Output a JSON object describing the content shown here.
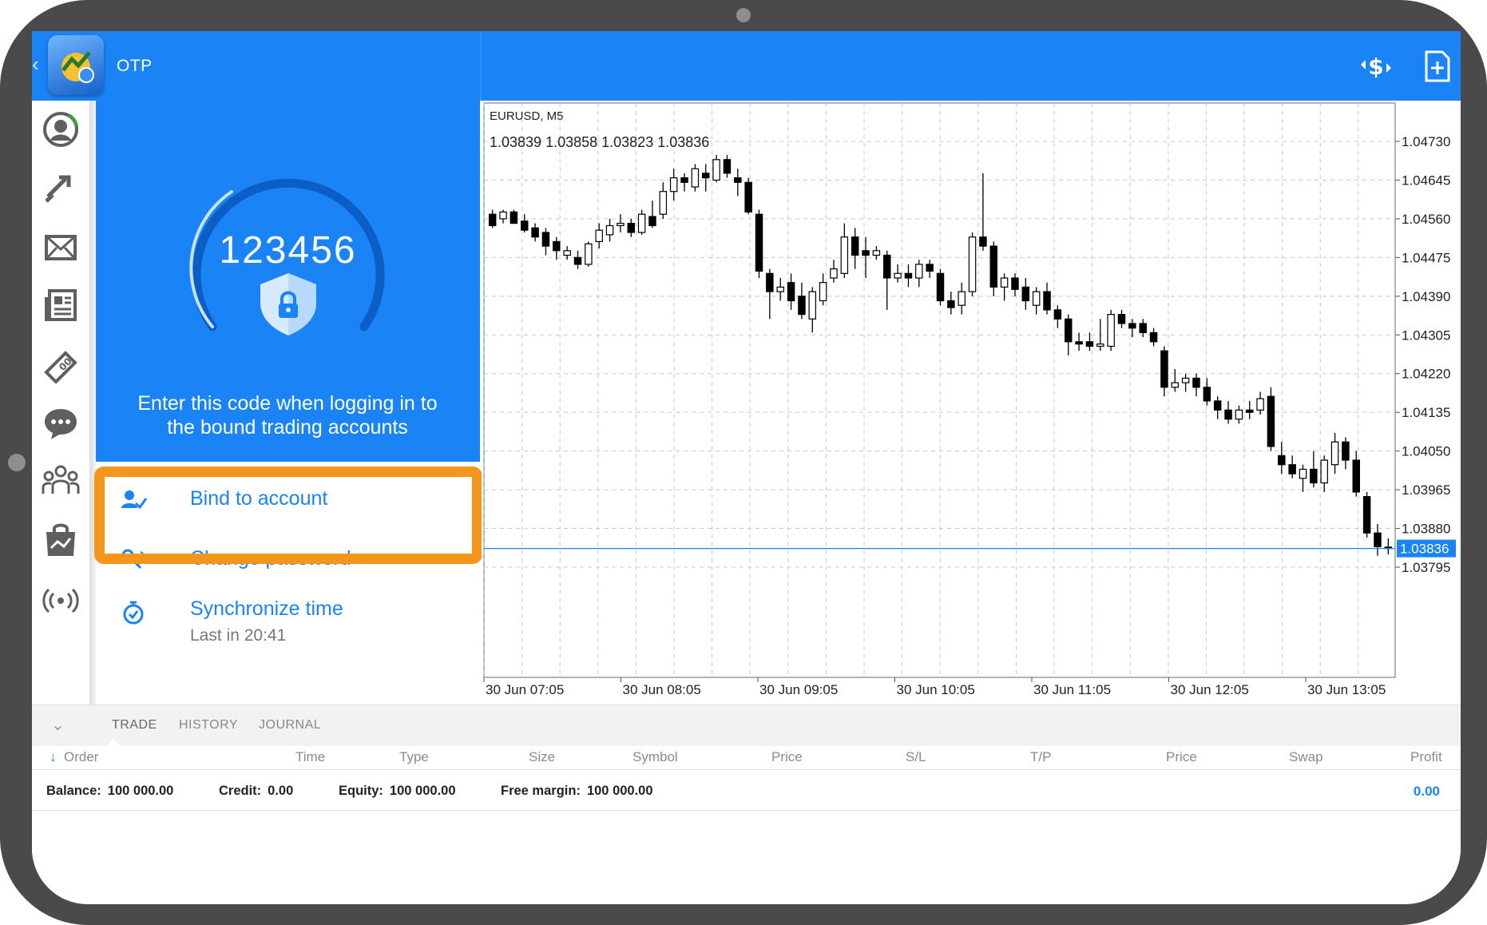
{
  "header": {
    "title": "OTP",
    "back_icon": "chevron-left-icon",
    "currency_icon": "currency-exchange-icon",
    "new_order_icon": "add-document-icon"
  },
  "sidebar": {
    "items": [
      {
        "icon": "account-icon"
      },
      {
        "icon": "trade-icon"
      },
      {
        "icon": "mail-icon"
      },
      {
        "icon": "news-icon"
      },
      {
        "icon": "calendar-icon"
      },
      {
        "icon": "chat-icon"
      },
      {
        "icon": "community-icon"
      },
      {
        "icon": "market-icon"
      },
      {
        "icon": "signals-icon"
      }
    ]
  },
  "otp": {
    "code": "123456",
    "hint": "Enter this code when logging in to the bound trading accounts",
    "lock_icon": "shield-lock-icon"
  },
  "menu": {
    "bind": {
      "label": "Bind to account",
      "icon": "bind-user-icon"
    },
    "change_password": {
      "label": "Change password",
      "icon": "key-icon"
    },
    "sync_time": {
      "label": "Synchronize time",
      "sub": "Last in 20:41",
      "icon": "timer-icon"
    }
  },
  "colors": {
    "accent": "#1a83f6",
    "highlight": "#f5961c",
    "bid_line": "#1a83f6"
  },
  "chart_data": {
    "type": "candlestick",
    "symbol": "EURUSD, M5",
    "ohlc_readout": "1.03839 1.03858 1.03823 1.03836",
    "current_price": "1.03836",
    "ylim": [
      1.0376,
      1.0477
    ],
    "y_ticks": [
      "1.04730",
      "1.04645",
      "1.04560",
      "1.04475",
      "1.04390",
      "1.04305",
      "1.04220",
      "1.04135",
      "1.04050",
      "1.03965",
      "1.03880",
      "1.03795"
    ],
    "y_tick_values": [
      1.0473,
      1.04645,
      1.0456,
      1.04475,
      1.0439,
      1.04305,
      1.0422,
      1.04135,
      1.0405,
      1.03965,
      1.0388,
      1.03795
    ],
    "x_ticks": [
      "30 Jun 07:05",
      "30 Jun 08:05",
      "30 Jun 09:05",
      "30 Jun 10:05",
      "30 Jun 11:05",
      "30 Jun 12:05",
      "30 Jun 13:05"
    ],
    "grid": true,
    "candles": [
      [
        1.0457,
        1.0458,
        1.0454,
        1.04545
      ],
      [
        1.0456,
        1.0458,
        1.0455,
        1.04575
      ],
      [
        1.04575,
        1.0458,
        1.0455,
        1.0455
      ],
      [
        1.04555,
        1.0457,
        1.0453,
        1.04535
      ],
      [
        1.0454,
        1.0455,
        1.0451,
        1.0452
      ],
      [
        1.0453,
        1.0454,
        1.0448,
        1.045
      ],
      [
        1.0451,
        1.0452,
        1.0447,
        1.0449
      ],
      [
        1.0448,
        1.045,
        1.0447,
        1.0449
      ],
      [
        1.04475,
        1.0449,
        1.0445,
        1.0446
      ],
      [
        1.0446,
        1.0451,
        1.04455,
        1.04505
      ],
      [
        1.0451,
        1.0455,
        1.04495,
        1.04535
      ],
      [
        1.04525,
        1.0456,
        1.0451,
        1.04545
      ],
      [
        1.04545,
        1.0457,
        1.0453,
        1.0455
      ],
      [
        1.0455,
        1.0456,
        1.0452,
        1.0453
      ],
      [
        1.0453,
        1.0458,
        1.04525,
        1.0457
      ],
      [
        1.04565,
        1.046,
        1.0454,
        1.04545
      ],
      [
        1.0457,
        1.0464,
        1.0456,
        1.0462
      ],
      [
        1.0462,
        1.0467,
        1.046,
        1.0465
      ],
      [
        1.0465,
        1.0466,
        1.0462,
        1.0464
      ],
      [
        1.0463,
        1.0468,
        1.0462,
        1.0467
      ],
      [
        1.0466,
        1.0468,
        1.0462,
        1.0465
      ],
      [
        1.04645,
        1.047,
        1.0464,
        1.0469
      ],
      [
        1.0469,
        1.047,
        1.0465,
        1.0466
      ],
      [
        1.0465,
        1.0467,
        1.0461,
        1.0464
      ],
      [
        1.0464,
        1.0465,
        1.0457,
        1.04575
      ],
      [
        1.0457,
        1.0458,
        1.0443,
        1.04445
      ],
      [
        1.0444,
        1.0445,
        1.0434,
        1.044
      ],
      [
        1.044,
        1.0443,
        1.0438,
        1.0441
      ],
      [
        1.0442,
        1.0444,
        1.0436,
        1.0438
      ],
      [
        1.0439,
        1.0442,
        1.0434,
        1.0435
      ],
      [
        1.0434,
        1.0441,
        1.0431,
        1.044
      ],
      [
        1.0438,
        1.0444,
        1.0437,
        1.0442
      ],
      [
        1.0443,
        1.0447,
        1.0442,
        1.0445
      ],
      [
        1.0444,
        1.0455,
        1.0443,
        1.0452
      ],
      [
        1.0452,
        1.0454,
        1.0445,
        1.0448
      ],
      [
        1.0449,
        1.0452,
        1.0443,
        1.0448
      ],
      [
        1.0448,
        1.045,
        1.0447,
        1.0449
      ],
      [
        1.0448,
        1.0449,
        1.0436,
        1.0443
      ],
      [
        1.0443,
        1.0446,
        1.0442,
        1.0444
      ],
      [
        1.0444,
        1.0446,
        1.0441,
        1.0443
      ],
      [
        1.0443,
        1.0447,
        1.0441,
        1.0446
      ],
      [
        1.0446,
        1.0447,
        1.0443,
        1.04445
      ],
      [
        1.0444,
        1.0445,
        1.0437,
        1.0438
      ],
      [
        1.0438,
        1.044,
        1.0435,
        1.04365
      ],
      [
        1.0437,
        1.0442,
        1.0435,
        1.044
      ],
      [
        1.044,
        1.0453,
        1.0439,
        1.0452
      ],
      [
        1.0452,
        1.0466,
        1.0449,
        1.045
      ],
      [
        1.045,
        1.0451,
        1.0439,
        1.0441
      ],
      [
        1.0441,
        1.0444,
        1.0438,
        1.0443
      ],
      [
        1.0443,
        1.0444,
        1.0439,
        1.04405
      ],
      [
        1.0441,
        1.0443,
        1.0436,
        1.0438
      ],
      [
        1.0437,
        1.0441,
        1.0435,
        1.044
      ],
      [
        1.044,
        1.0442,
        1.0435,
        1.0436
      ],
      [
        1.0436,
        1.0437,
        1.0432,
        1.0434
      ],
      [
        1.0434,
        1.0435,
        1.0426,
        1.0429
      ],
      [
        1.0429,
        1.0431,
        1.0427,
        1.04285
      ],
      [
        1.0429,
        1.0431,
        1.0427,
        1.0428
      ],
      [
        1.0428,
        1.0434,
        1.0427,
        1.04285
      ],
      [
        1.0428,
        1.0436,
        1.0427,
        1.0435
      ],
      [
        1.0435,
        1.0436,
        1.0432,
        1.0433
      ],
      [
        1.0433,
        1.0434,
        1.043,
        1.0432
      ],
      [
        1.0433,
        1.0434,
        1.043,
        1.0431
      ],
      [
        1.0431,
        1.0432,
        1.0428,
        1.0429
      ],
      [
        1.0427,
        1.0428,
        1.0417,
        1.0419
      ],
      [
        1.0419,
        1.0423,
        1.0418,
        1.042
      ],
      [
        1.042,
        1.0422,
        1.0418,
        1.0421
      ],
      [
        1.0421,
        1.0422,
        1.0417,
        1.0419
      ],
      [
        1.0419,
        1.0421,
        1.0415,
        1.0416
      ],
      [
        1.0416,
        1.0417,
        1.0412,
        1.0414
      ],
      [
        1.0414,
        1.0416,
        1.0411,
        1.0412
      ],
      [
        1.0412,
        1.0415,
        1.0411,
        1.0414
      ],
      [
        1.0414,
        1.0416,
        1.0412,
        1.04135
      ],
      [
        1.0414,
        1.0418,
        1.0413,
        1.04165
      ],
      [
        1.0417,
        1.0419,
        1.0405,
        1.0406
      ],
      [
        1.0404,
        1.0407,
        1.04,
        1.0402
      ],
      [
        1.0402,
        1.0404,
        1.0399,
        1.04
      ],
      [
        1.0399,
        1.0402,
        1.0396,
        1.0401
      ],
      [
        1.0401,
        1.0405,
        1.0397,
        1.0398
      ],
      [
        1.0398,
        1.0404,
        1.0396,
        1.0403
      ],
      [
        1.0402,
        1.0409,
        1.04,
        1.0407
      ],
      [
        1.0407,
        1.0408,
        1.0401,
        1.0403
      ],
      [
        1.0403,
        1.0405,
        1.0395,
        1.0396
      ],
      [
        1.0395,
        1.0396,
        1.0386,
        1.0387
      ],
      [
        1.0387,
        1.0389,
        1.0382,
        1.0384
      ],
      [
        1.03839,
        1.03858,
        1.03823,
        1.03836
      ]
    ]
  },
  "bottom": {
    "collapse_icon": "chevron-down-icon",
    "tabs": [
      "TRADE",
      "HISTORY",
      "JOURNAL"
    ],
    "columns": [
      "Order",
      "Time",
      "Type",
      "Size",
      "Symbol",
      "Price",
      "S/L",
      "T/P",
      "Price",
      "Swap",
      "Profit"
    ],
    "sort_icon": "sort-down-arrow-icon",
    "balance": {
      "label": "Balance:",
      "value": "100 000.00"
    },
    "credit": {
      "label": "Credit:",
      "value": "0.00"
    },
    "equity": {
      "label": "Equity:",
      "value": "100 000.00"
    },
    "free_margin": {
      "label": "Free margin:",
      "value": "100 000.00"
    },
    "profit": "0.00"
  }
}
